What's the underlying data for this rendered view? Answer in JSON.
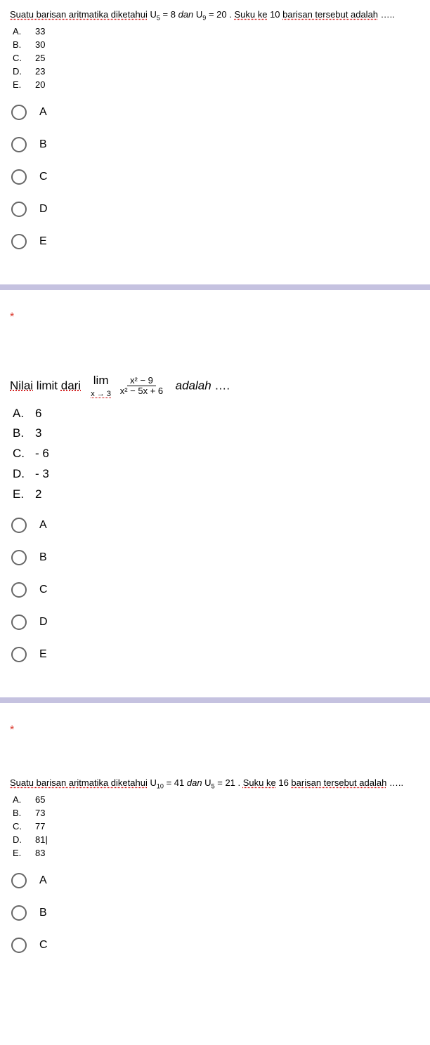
{
  "q1": {
    "text_parts": {
      "p1": "Suatu barisan aritmatika diketahui",
      "p2": "U",
      "s1": "5",
      "p3": " = 8 ",
      "p4": "dan",
      "p5": " U",
      "s2": "9",
      "p6": " = 20 . ",
      "p7": "Suku ke",
      "p8": " 10 ",
      "p9": "barisan tersebut adalah",
      "p10": " ….."
    },
    "answers": [
      {
        "letter": "A.",
        "value": "33"
      },
      {
        "letter": "B.",
        "value": "30"
      },
      {
        "letter": "C.",
        "value": "25"
      },
      {
        "letter": "D.",
        "value": "23"
      },
      {
        "letter": "E.",
        "value": "20"
      }
    ],
    "radios": [
      "A",
      "B",
      "C",
      "D",
      "E"
    ]
  },
  "q2": {
    "required": "*",
    "text_parts": {
      "p1": "Nilai",
      "p2": " limit ",
      "p3": "dari",
      "lim_top": "lim",
      "lim_bot": "x → 3",
      "num": "x² − 9",
      "den": "x² − 5x + 6",
      "p4": "adalah",
      "p5": " …."
    },
    "answers": [
      {
        "letter": "A.",
        "value": "6"
      },
      {
        "letter": "B.",
        "value": "3"
      },
      {
        "letter": "C.",
        "value": "- 6"
      },
      {
        "letter": "D.",
        "value": "- 3"
      },
      {
        "letter": "E.",
        "value": "2"
      }
    ],
    "radios": [
      "A",
      "B",
      "C",
      "D",
      "E"
    ]
  },
  "q3": {
    "required": "*",
    "text_parts": {
      "p1": "Suatu barisan aritmatika diketahui",
      "p2": " U",
      "s1": "10",
      "p3": " = 41 ",
      "p4": "dan",
      "p5": " U",
      "s2": "5",
      "p6": " = 21 . ",
      "p7": "Suku ke",
      "p8": " 16 ",
      "p9": "barisan tersebut adalah",
      "p10": " ….."
    },
    "answers": [
      {
        "letter": "A.",
        "value": "65"
      },
      {
        "letter": "B.",
        "value": "73"
      },
      {
        "letter": "C.",
        "value": "77"
      },
      {
        "letter": "D.",
        "value": "81|"
      },
      {
        "letter": "E.",
        "value": "83"
      }
    ],
    "radios": [
      "A",
      "B",
      "C"
    ]
  }
}
